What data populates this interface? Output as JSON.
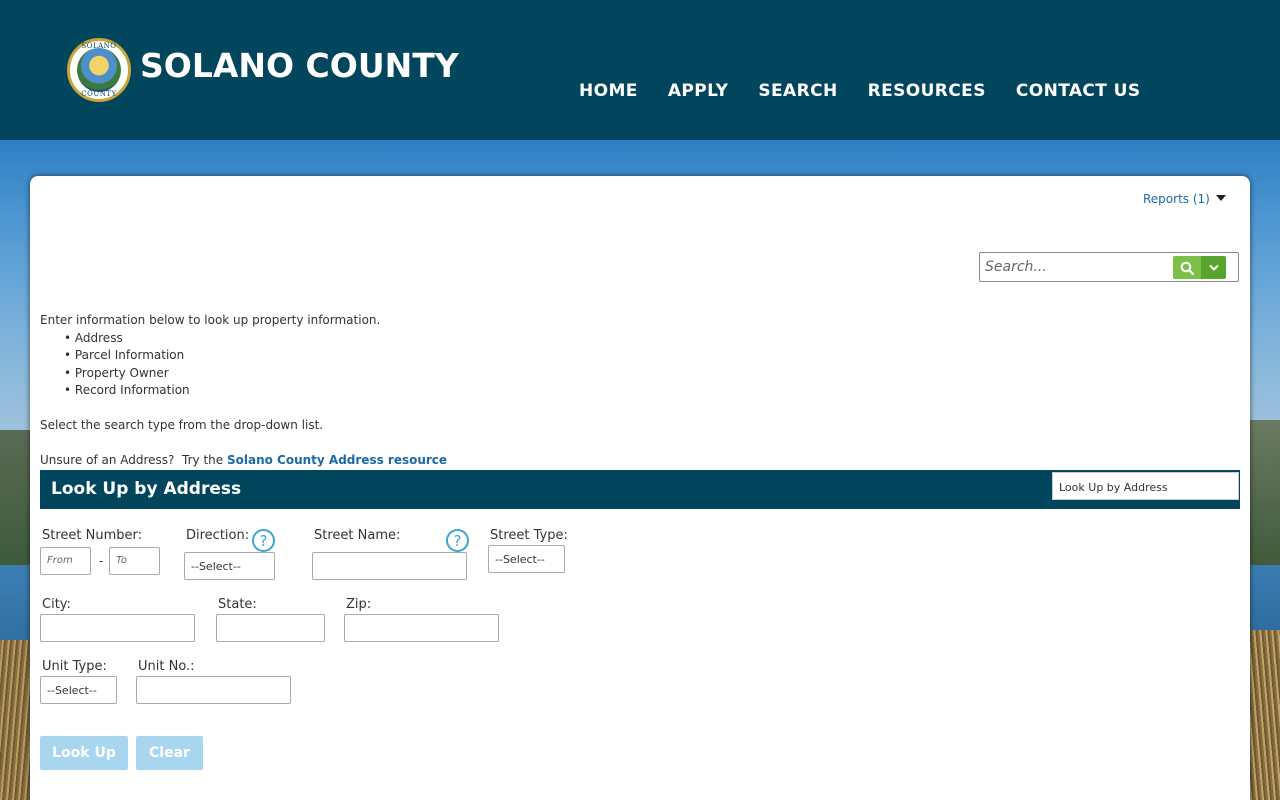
{
  "header": {
    "seal_text_top": "SOLANO",
    "seal_text_bottom": "COUNTY",
    "brand": "SOLANO COUNTY",
    "nav": [
      "HOME",
      "APPLY",
      "SEARCH",
      "RESOURCES",
      "CONTACT US"
    ]
  },
  "toolbar": {
    "reports_label": "Reports (1)",
    "search_placeholder": "Search..."
  },
  "intro": {
    "lead": "Enter information below to look up property information.",
    "items": [
      "Address",
      "Parcel Information",
      "Property Owner",
      "Record Information"
    ],
    "select_hint": "Select the search type from the drop-down list.",
    "unsure_text": "Unsure of an Address?  Try the ",
    "unsure_link": "Solano County Address resource"
  },
  "section": {
    "title": "Look Up by Address",
    "search_type": "Look Up by Address"
  },
  "form": {
    "street_number_label": "Street Number:",
    "from_placeholder": "From",
    "to_placeholder": "To",
    "range_separator": "-",
    "direction_label": "Direction:",
    "direction_value": "--Select--",
    "street_name_label": "Street Name:",
    "street_type_label": "Street Type:",
    "street_type_value": "--Select--",
    "city_label": "City:",
    "state_label": "State:",
    "zip_label": "Zip:",
    "unit_type_label": "Unit Type:",
    "unit_type_value": "--Select--",
    "unit_no_label": "Unit No.:",
    "help_glyph": "?"
  },
  "actions": {
    "lookup_label": "Look Up",
    "clear_label": "Clear"
  },
  "colors": {
    "header_bg": "#02465e",
    "link": "#1b6aa6",
    "search_green": "#7cc04a",
    "button_disabled": "#a8d6ee"
  }
}
